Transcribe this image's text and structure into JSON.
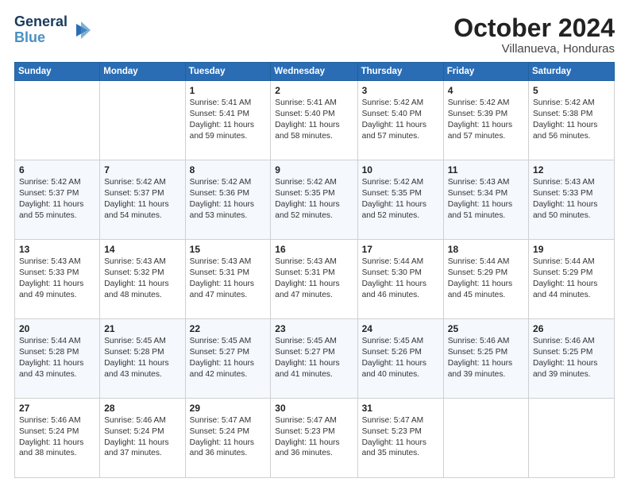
{
  "header": {
    "logo_line1": "General",
    "logo_line2": "Blue",
    "month_title": "October 2024",
    "subtitle": "Villanueva, Honduras"
  },
  "weekdays": [
    "Sunday",
    "Monday",
    "Tuesday",
    "Wednesday",
    "Thursday",
    "Friday",
    "Saturday"
  ],
  "weeks": [
    [
      {
        "day": "",
        "info": ""
      },
      {
        "day": "",
        "info": ""
      },
      {
        "day": "1",
        "info": "Sunrise: 5:41 AM\nSunset: 5:41 PM\nDaylight: 11 hours and 59 minutes."
      },
      {
        "day": "2",
        "info": "Sunrise: 5:41 AM\nSunset: 5:40 PM\nDaylight: 11 hours and 58 minutes."
      },
      {
        "day": "3",
        "info": "Sunrise: 5:42 AM\nSunset: 5:40 PM\nDaylight: 11 hours and 57 minutes."
      },
      {
        "day": "4",
        "info": "Sunrise: 5:42 AM\nSunset: 5:39 PM\nDaylight: 11 hours and 57 minutes."
      },
      {
        "day": "5",
        "info": "Sunrise: 5:42 AM\nSunset: 5:38 PM\nDaylight: 11 hours and 56 minutes."
      }
    ],
    [
      {
        "day": "6",
        "info": "Sunrise: 5:42 AM\nSunset: 5:37 PM\nDaylight: 11 hours and 55 minutes."
      },
      {
        "day": "7",
        "info": "Sunrise: 5:42 AM\nSunset: 5:37 PM\nDaylight: 11 hours and 54 minutes."
      },
      {
        "day": "8",
        "info": "Sunrise: 5:42 AM\nSunset: 5:36 PM\nDaylight: 11 hours and 53 minutes."
      },
      {
        "day": "9",
        "info": "Sunrise: 5:42 AM\nSunset: 5:35 PM\nDaylight: 11 hours and 52 minutes."
      },
      {
        "day": "10",
        "info": "Sunrise: 5:42 AM\nSunset: 5:35 PM\nDaylight: 11 hours and 52 minutes."
      },
      {
        "day": "11",
        "info": "Sunrise: 5:43 AM\nSunset: 5:34 PM\nDaylight: 11 hours and 51 minutes."
      },
      {
        "day": "12",
        "info": "Sunrise: 5:43 AM\nSunset: 5:33 PM\nDaylight: 11 hours and 50 minutes."
      }
    ],
    [
      {
        "day": "13",
        "info": "Sunrise: 5:43 AM\nSunset: 5:33 PM\nDaylight: 11 hours and 49 minutes."
      },
      {
        "day": "14",
        "info": "Sunrise: 5:43 AM\nSunset: 5:32 PM\nDaylight: 11 hours and 48 minutes."
      },
      {
        "day": "15",
        "info": "Sunrise: 5:43 AM\nSunset: 5:31 PM\nDaylight: 11 hours and 47 minutes."
      },
      {
        "day": "16",
        "info": "Sunrise: 5:43 AM\nSunset: 5:31 PM\nDaylight: 11 hours and 47 minutes."
      },
      {
        "day": "17",
        "info": "Sunrise: 5:44 AM\nSunset: 5:30 PM\nDaylight: 11 hours and 46 minutes."
      },
      {
        "day": "18",
        "info": "Sunrise: 5:44 AM\nSunset: 5:29 PM\nDaylight: 11 hours and 45 minutes."
      },
      {
        "day": "19",
        "info": "Sunrise: 5:44 AM\nSunset: 5:29 PM\nDaylight: 11 hours and 44 minutes."
      }
    ],
    [
      {
        "day": "20",
        "info": "Sunrise: 5:44 AM\nSunset: 5:28 PM\nDaylight: 11 hours and 43 minutes."
      },
      {
        "day": "21",
        "info": "Sunrise: 5:45 AM\nSunset: 5:28 PM\nDaylight: 11 hours and 43 minutes."
      },
      {
        "day": "22",
        "info": "Sunrise: 5:45 AM\nSunset: 5:27 PM\nDaylight: 11 hours and 42 minutes."
      },
      {
        "day": "23",
        "info": "Sunrise: 5:45 AM\nSunset: 5:27 PM\nDaylight: 11 hours and 41 minutes."
      },
      {
        "day": "24",
        "info": "Sunrise: 5:45 AM\nSunset: 5:26 PM\nDaylight: 11 hours and 40 minutes."
      },
      {
        "day": "25",
        "info": "Sunrise: 5:46 AM\nSunset: 5:25 PM\nDaylight: 11 hours and 39 minutes."
      },
      {
        "day": "26",
        "info": "Sunrise: 5:46 AM\nSunset: 5:25 PM\nDaylight: 11 hours and 39 minutes."
      }
    ],
    [
      {
        "day": "27",
        "info": "Sunrise: 5:46 AM\nSunset: 5:24 PM\nDaylight: 11 hours and 38 minutes."
      },
      {
        "day": "28",
        "info": "Sunrise: 5:46 AM\nSunset: 5:24 PM\nDaylight: 11 hours and 37 minutes."
      },
      {
        "day": "29",
        "info": "Sunrise: 5:47 AM\nSunset: 5:24 PM\nDaylight: 11 hours and 36 minutes."
      },
      {
        "day": "30",
        "info": "Sunrise: 5:47 AM\nSunset: 5:23 PM\nDaylight: 11 hours and 36 minutes."
      },
      {
        "day": "31",
        "info": "Sunrise: 5:47 AM\nSunset: 5:23 PM\nDaylight: 11 hours and 35 minutes."
      },
      {
        "day": "",
        "info": ""
      },
      {
        "day": "",
        "info": ""
      }
    ]
  ]
}
